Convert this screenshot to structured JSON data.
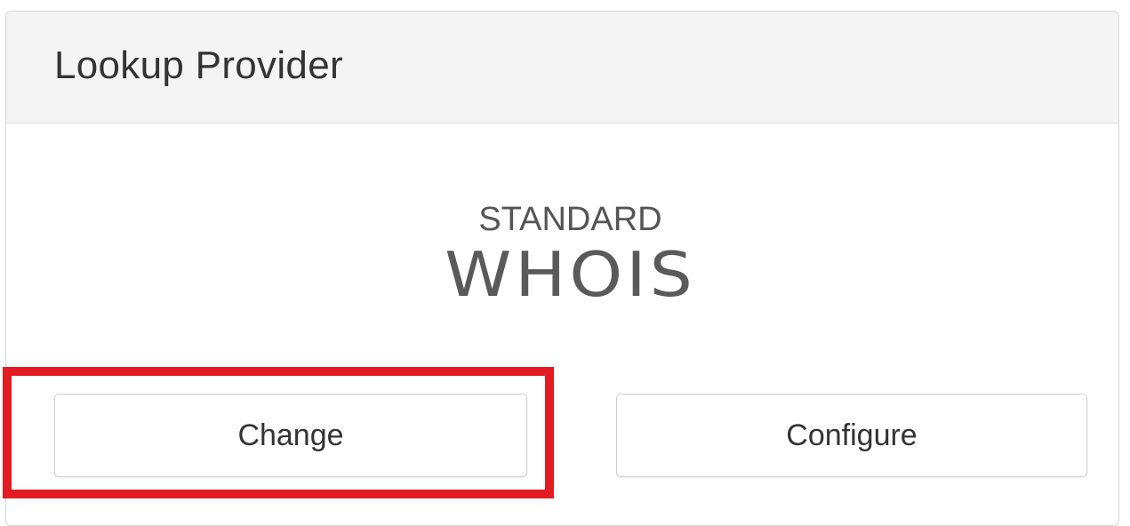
{
  "panel": {
    "title": "Lookup Provider"
  },
  "provider_logo": {
    "line1": "STANDARD",
    "line2": "WHOIS"
  },
  "actions": {
    "change_label": "Change",
    "configure_label": "Configure"
  },
  "annotation": {
    "highlight_color": "#e31b23",
    "highlighted_target": "change-button"
  }
}
